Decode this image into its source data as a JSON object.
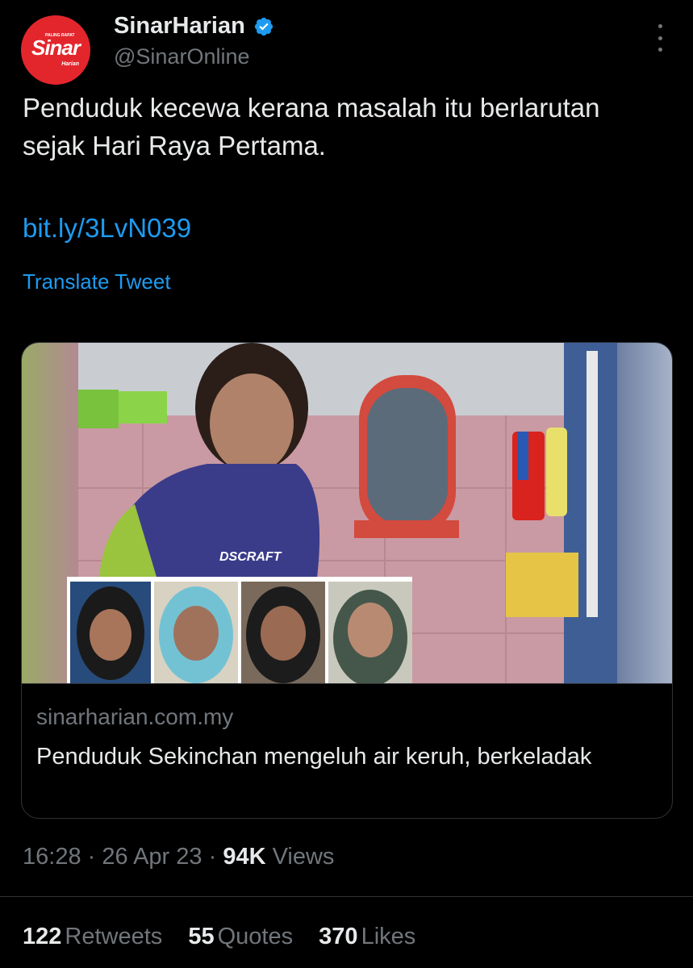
{
  "author": {
    "avatar_text": "Sinar",
    "avatar_subtext": "Harian",
    "avatar_toptext": "PALING RAPAT",
    "display_name": "SinarHarian",
    "handle": "@SinarOnline",
    "verified": true,
    "brand_color": "#e3262c",
    "verified_color": "#1d9bf0"
  },
  "tweet": {
    "text": "Penduduk kecewa kerana masalah itu berlarutan sejak Hari Raya Pertama.",
    "link": "bit.ly/3LvN039",
    "translate_label": "Translate Tweet"
  },
  "card": {
    "domain": "sinarharian.com.my",
    "title": "Penduduk Sekinchan mengeluh air keruh, berkeladak",
    "image_logo_text": "DSCRAFT"
  },
  "meta": {
    "time": "16:28",
    "date": "26 Apr 23",
    "views_count": "94K",
    "views_label": "Views",
    "separator": "·"
  },
  "stats": [
    {
      "count": "122",
      "label": "Retweets"
    },
    {
      "count": "55",
      "label": "Quotes"
    },
    {
      "count": "370",
      "label": "Likes"
    }
  ],
  "icons": {
    "more": "more-vertical-icon",
    "verified": "verified-badge-icon"
  },
  "colors": {
    "background": "#000000",
    "text": "#e7e9ea",
    "muted": "#71767b",
    "link": "#1d9bf0",
    "border": "#2f3336"
  }
}
